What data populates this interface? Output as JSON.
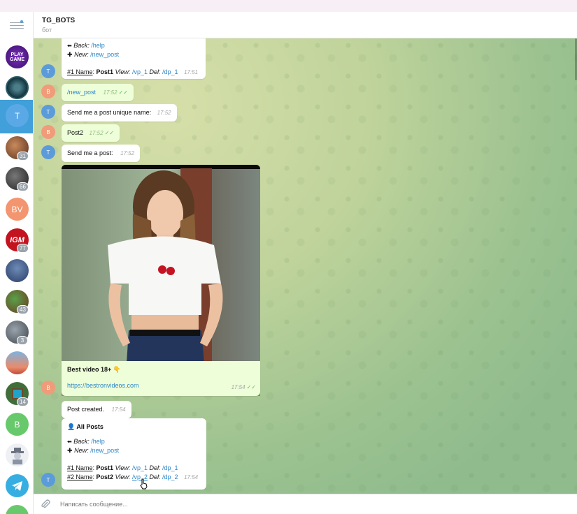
{
  "header": {
    "title": "TG_BOTS",
    "subtitle": "бот"
  },
  "sidebar": {
    "items": [
      {
        "name": "playgame",
        "label": "PLAY GAME",
        "badge": ""
      },
      {
        "name": "channel-2",
        "label": "",
        "badge": ""
      },
      {
        "name": "tg-bots",
        "label": "T",
        "badge": ""
      },
      {
        "name": "chat-4",
        "label": "",
        "badge": "31"
      },
      {
        "name": "chat-5",
        "label": "",
        "badge": "66"
      },
      {
        "name": "bv",
        "label": "BV",
        "badge": ""
      },
      {
        "name": "igm",
        "label": "IGM",
        "badge": "77"
      },
      {
        "name": "chat-8",
        "label": "",
        "badge": ""
      },
      {
        "name": "chat-9",
        "label": "",
        "badge": "43"
      },
      {
        "name": "chat-10",
        "label": "",
        "badge": "3"
      },
      {
        "name": "chat-11",
        "label": "",
        "badge": ""
      },
      {
        "name": "chat-12",
        "label": "",
        "badge": "14"
      },
      {
        "name": "b",
        "label": "B",
        "badge": ""
      },
      {
        "name": "chat-14",
        "label": "",
        "badge": ""
      },
      {
        "name": "telegram",
        "label": "",
        "badge": ""
      }
    ]
  },
  "messages": {
    "m1": {
      "back_label": "Back:",
      "back_cmd": "/help",
      "new_label": "New:",
      "new_cmd": "/new_post",
      "row_num": "#1 Name",
      "row_name": "Post1",
      "row_view_label": "View:",
      "row_view": "/vp_1",
      "row_del_label": "Del:",
      "row_del": "/dp_1",
      "time": "17:51"
    },
    "m2": {
      "text": "/new_post",
      "time": "17:52"
    },
    "m3": {
      "text": "Send me a post unique name:",
      "time": "17:52"
    },
    "m4": {
      "text": "Post2",
      "time": "17:52"
    },
    "m5": {
      "text": "Send me a post:",
      "time": "17:52"
    },
    "m6": {
      "caption": "Best video 18+ 👇",
      "link": "https://bestronvideos.com",
      "time": "17:54"
    },
    "m7": {
      "text": "Post created.",
      "time": "17:54"
    },
    "m8": {
      "title": "All Posts",
      "back_label": "Back:",
      "back_cmd": "/help",
      "new_label": "New:",
      "new_cmd": "/new_post",
      "rows": [
        {
          "num": "#1 Name",
          "name": "Post1",
          "view_label": "View:",
          "view": "/vp_1",
          "del_label": "Del:",
          "del": "/dp_1"
        },
        {
          "num": "#2 Name",
          "name": "Post2",
          "view_label": "View:",
          "view": "/vp_2",
          "del_label": "Del:",
          "del": "/dp_2"
        }
      ],
      "time": "17:54"
    }
  },
  "avatars": {
    "bot_letter": "T",
    "user_letter": "B"
  },
  "input": {
    "placeholder": "Написать сообщение..."
  },
  "colors": {
    "accent": "#419fd9",
    "link": "#2a86c8",
    "outgoing": "#eefed9",
    "check": "#62b866"
  }
}
